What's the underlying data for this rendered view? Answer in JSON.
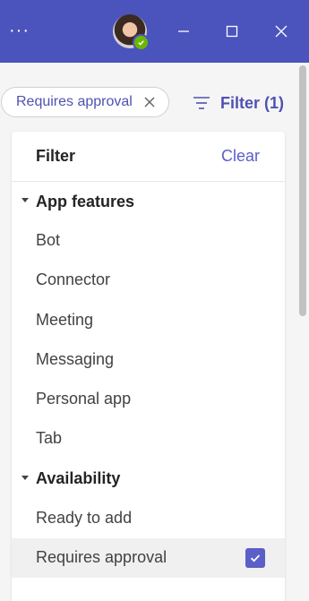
{
  "titlebar": {
    "more_label": "···",
    "accent": "#4b53bc",
    "icons": [
      "more-icon",
      "avatar",
      "minimize-icon",
      "maximize-icon",
      "close-icon"
    ]
  },
  "chip": {
    "label": "Requires approval",
    "icon": "close-icon"
  },
  "filter_button": {
    "label": "Filter (1)",
    "icon": "filter-icon"
  },
  "panel": {
    "title": "Filter",
    "clear_label": "Clear",
    "sections": [
      {
        "label": "App features",
        "expanded": true,
        "options": [
          {
            "label": "Bot",
            "checked": false
          },
          {
            "label": "Connector",
            "checked": false
          },
          {
            "label": "Meeting",
            "checked": false
          },
          {
            "label": "Messaging",
            "checked": false
          },
          {
            "label": "Personal app",
            "checked": false
          },
          {
            "label": "Tab",
            "checked": false
          }
        ]
      },
      {
        "label": "Availability",
        "expanded": true,
        "options": [
          {
            "label": "Ready to add",
            "checked": false
          },
          {
            "label": "Requires approval",
            "checked": true
          }
        ]
      }
    ]
  },
  "colors": {
    "brand": "#5b5fc7",
    "presence_available": "#6bb700"
  }
}
